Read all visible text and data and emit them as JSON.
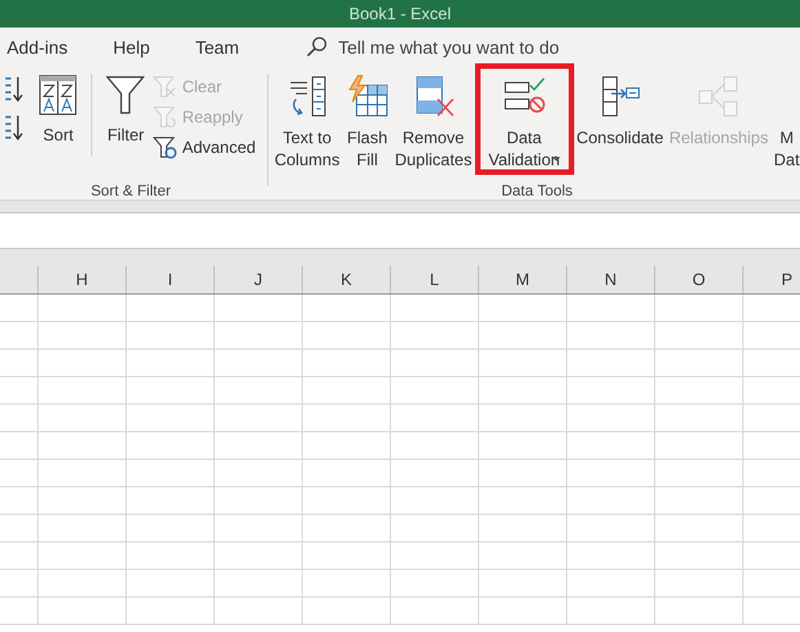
{
  "window": {
    "title": "Book1  -  Excel"
  },
  "tabs": [
    {
      "label": "Add-ins",
      "selected": false
    },
    {
      "label": "Help",
      "selected": false
    },
    {
      "label": "Team",
      "selected": false
    }
  ],
  "search": {
    "placeholder": "Tell me what you want to do"
  },
  "ribbon": {
    "groups": [
      {
        "label": "Sort & Filter",
        "buttons": [
          {
            "kind": "sort-pair",
            "disabled": false
          },
          {
            "kind": "large",
            "lines": [
              "Sort"
            ],
            "disabled": false
          },
          {
            "kind": "large",
            "lines": [
              "Filter"
            ],
            "disabled": false
          },
          {
            "kind": "small",
            "lines": [
              "Clear"
            ],
            "disabled": true
          },
          {
            "kind": "small",
            "lines": [
              "Reapply"
            ],
            "disabled": true
          },
          {
            "kind": "small",
            "lines": [
              "Advanced"
            ],
            "disabled": false
          }
        ]
      },
      {
        "label": "Data Tools",
        "buttons": [
          {
            "kind": "large",
            "lines": [
              "Text to",
              "Columns"
            ],
            "disabled": false
          },
          {
            "kind": "large",
            "lines": [
              "Flash",
              "Fill"
            ],
            "disabled": false
          },
          {
            "kind": "large",
            "lines": [
              "Remove",
              "Duplicates"
            ],
            "disabled": false
          },
          {
            "kind": "large",
            "lines": [
              "Data",
              "Validation"
            ],
            "disabled": false,
            "menu": true
          },
          {
            "kind": "large",
            "lines": [
              "Consolidate"
            ],
            "disabled": false
          },
          {
            "kind": "large",
            "lines": [
              "Relationships"
            ],
            "disabled": true
          },
          {
            "kind": "large",
            "lines": [
              "M",
              "Dat"
            ],
            "disabled": false
          }
        ]
      }
    ]
  },
  "highlight": {
    "shown": true,
    "color": "#e81c24"
  },
  "sheet": {
    "columns": [
      "H",
      "I",
      "J",
      "K",
      "L",
      "M",
      "N",
      "O",
      "P"
    ]
  }
}
